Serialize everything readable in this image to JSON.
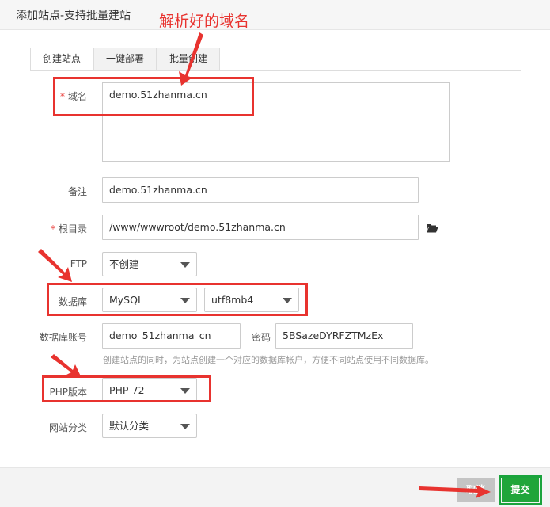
{
  "window": {
    "title": "添加站点-支持批量建站"
  },
  "annotation": {
    "text": "解析好的域名",
    "color": "#e8332f"
  },
  "tabs": [
    {
      "label": "创建站点",
      "active": true
    },
    {
      "label": "一键部署",
      "active": false
    },
    {
      "label": "批量创建",
      "active": false
    }
  ],
  "form": {
    "domain": {
      "label": "域名",
      "required": true,
      "value": "demo.51zhanma.cn"
    },
    "remark": {
      "label": "备注",
      "value": "demo.51zhanma.cn"
    },
    "root": {
      "label": "根目录",
      "required": true,
      "value": "/www/wwwroot/demo.51zhanma.cn",
      "icon": "folder-open-icon"
    },
    "ftp": {
      "label": "FTP",
      "selected": "不创建"
    },
    "database": {
      "label": "数据库",
      "type_selected": "MySQL",
      "charset_selected": "utf8mb4"
    },
    "db_account": {
      "label": "数据库账号",
      "value": "demo_51zhanma_cn",
      "password_label": "密码",
      "password_value": "5BSazeDYRFZTMzEx"
    },
    "db_hint": "创建站点的同时，为站点创建一个对应的数据库帐户，方便不同站点使用不同数据库。",
    "php": {
      "label": "PHP版本",
      "selected": "PHP-72"
    },
    "category": {
      "label": "网站分类",
      "selected": "默认分类"
    }
  },
  "footer": {
    "cancel_label": "取消",
    "submit_label": "提交"
  },
  "colors": {
    "accent": "#20a53a",
    "annotation": "#e8332f"
  }
}
